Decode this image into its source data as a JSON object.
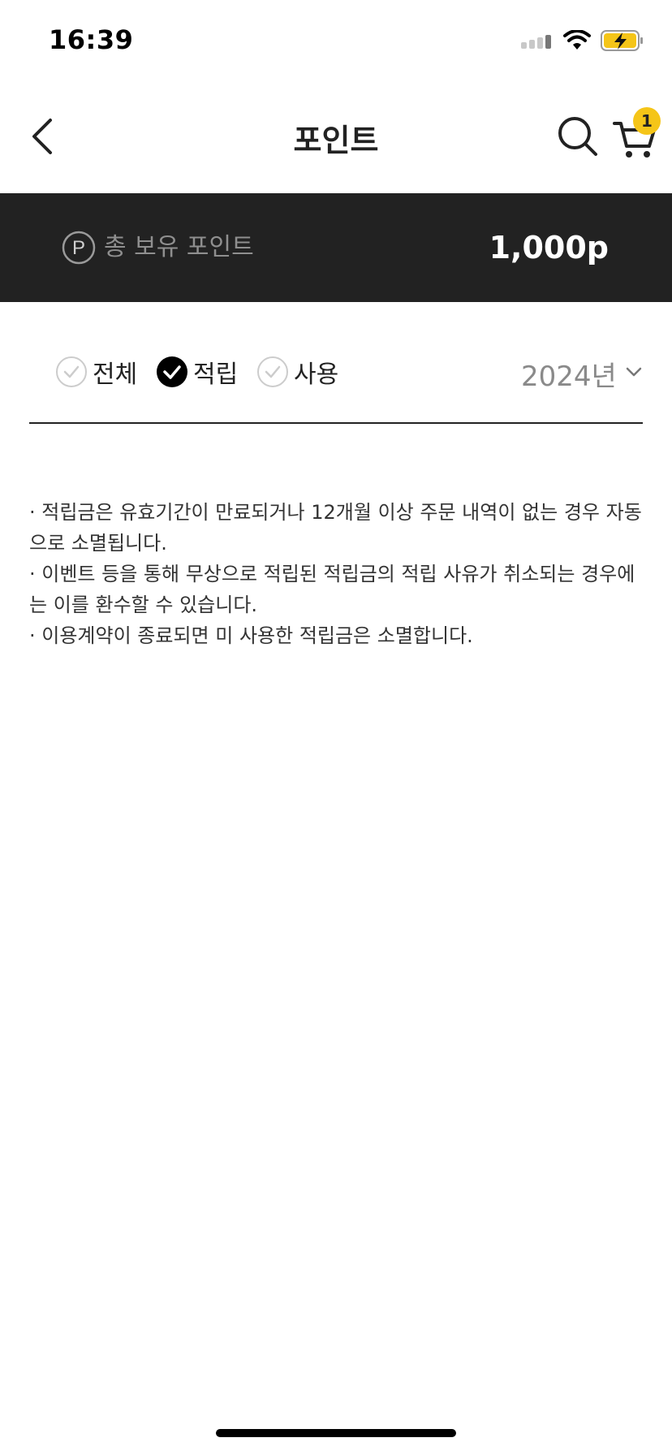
{
  "status_bar": {
    "time": "16:39"
  },
  "header": {
    "title": "포인트",
    "cart_count": "1"
  },
  "points_banner": {
    "icon_letter": "P",
    "label": "총 보유 포인트",
    "value": "1,000p"
  },
  "filters": {
    "options": [
      {
        "label": "전체",
        "selected": false
      },
      {
        "label": "적립",
        "selected": true
      },
      {
        "label": "사용",
        "selected": false
      }
    ],
    "year": "2024년"
  },
  "notes": [
    "· 적립금은 유효기간이 만료되거나 12개월 이상 주문 내역이 없는 경우 자동으로 소멸됩니다.",
    "· 이벤트 등을 통해 무상으로 적립된 적립금의 적립 사유가 취소되는 경우에는 이를 환수할 수 있습니다.",
    "· 이용계약이 종료되면 미 사용한 적립금은 소멸합니다."
  ],
  "colors": {
    "banner_bg": "#222222",
    "badge": "#f5c518",
    "battery": "#f5c518"
  },
  "icons": {
    "back": "chevron-left-icon",
    "search": "search-icon",
    "cart": "cart-icon",
    "points": "points-circle-icon",
    "check_on": "check-circle-filled-icon",
    "check_off": "check-circle-outline-icon",
    "dropdown": "chevron-down-icon"
  }
}
